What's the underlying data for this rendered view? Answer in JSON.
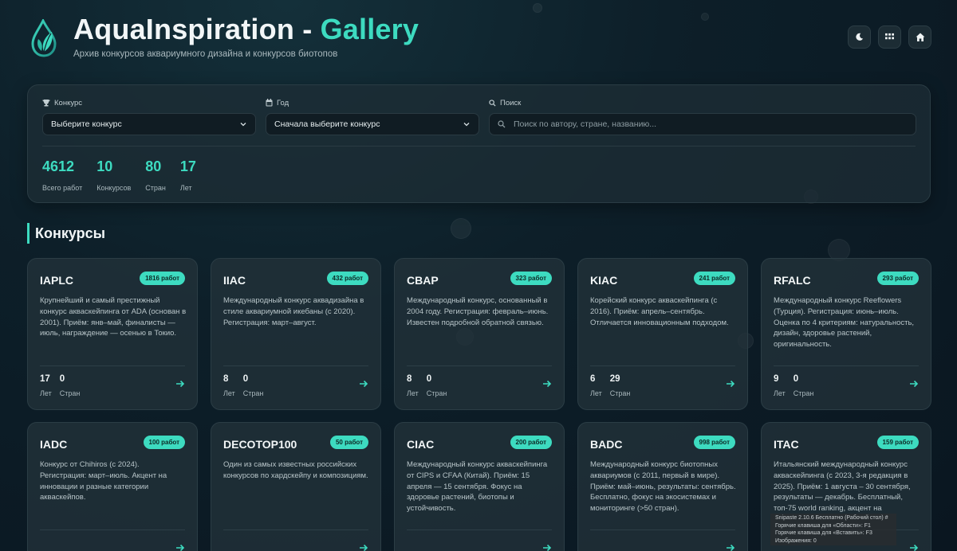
{
  "header": {
    "title_main": "AquaInspiration - ",
    "title_accent": "Gallery",
    "subtitle": "Архив конкурсов аквариумного дизайна и конкурсов биотопов",
    "buttons": [
      {
        "icon": "moon-icon"
      },
      {
        "icon": "grid-icon"
      },
      {
        "icon": "home-icon"
      }
    ]
  },
  "filters": {
    "contest": {
      "label": "Конкурс",
      "icon": "trophy-icon",
      "value": "Выберите конкурс"
    },
    "year": {
      "label": "Год",
      "icon": "calendar-icon",
      "value": "Сначала выберите конкурс"
    },
    "search": {
      "label": "Поиск",
      "icon": "search-icon",
      "placeholder": "Поиск по автору, стране, названию..."
    }
  },
  "stats": [
    {
      "value": "4612",
      "label": "Всего работ"
    },
    {
      "value": "10",
      "label": "Конкурсов"
    },
    {
      "value": "80",
      "label": "Стран"
    },
    {
      "value": "17",
      "label": "Лет"
    }
  ],
  "section": {
    "title": "Конкурсы"
  },
  "card_labels": {
    "years": "Лет",
    "countries": "Стран"
  },
  "cards": [
    {
      "name": "IAPLC",
      "badge": "1816 работ",
      "desc": "Крупнейший и самый престижный конкурс акваскейпинга от ADA (основан в 2001). Приём: янв–май, финалисты — июль, награждение — осенью в Токио.",
      "years": "17",
      "countries": "0"
    },
    {
      "name": "IIAC",
      "badge": "432 работ",
      "desc": "Международный конкурс аквадизайна в стиле аквариумной икебаны (с 2020). Регистрация: март–август.",
      "years": "8",
      "countries": "0"
    },
    {
      "name": "CBAP",
      "badge": "323 работ",
      "desc": "Международный конкурс, основанный в 2004 году. Регистрация: февраль–июнь. Известен подробной обратной связью.",
      "years": "8",
      "countries": "0"
    },
    {
      "name": "KIAC",
      "badge": "241 работ",
      "desc": "Корейский конкурс акваскейпинга (с 2016). Приём: апрель–сентябрь. Отличается инновационным подходом.",
      "years": "6",
      "countries": "29"
    },
    {
      "name": "RFALC",
      "badge": "293 работ",
      "desc": "Международный конкурс Reeflowers (Турция). Регистрация: июнь–июль. Оценка по 4 критериям: натуральность, дизайн, здоровье растений, оригинальность.",
      "years": "9",
      "countries": "0"
    },
    {
      "name": "IADC",
      "badge": "100 работ",
      "desc": "Конкурс от Chihiros (с 2024). Регистрация: март–июль. Акцент на инновации и разные категории аквaскейпов.",
      "years": "",
      "countries": ""
    },
    {
      "name": "DECOTOP100",
      "badge": "50 работ",
      "desc": "Один из самых известных российских конкурсов по хардскейпу и композициям.",
      "years": "",
      "countries": ""
    },
    {
      "name": "CIAC",
      "badge": "200 работ",
      "desc": "Международный конкурс акваскейпинга от CIPS и CFAA (Китай). Приём: 15 апреля — 15 сентября. Фокус на здоровье растений, биотопы и устойчивость.",
      "years": "",
      "countries": ""
    },
    {
      "name": "BADC",
      "badge": "998 работ",
      "desc": "Международный конкурс биотопных аквариумов (с 2011, первый в мире). Приём: май–июнь, результаты: сентябрь. Бесплатно, фокус на экосистемах и мониторинге (>50 стран).",
      "years": "",
      "countries": ""
    },
    {
      "name": "ITAC",
      "badge": "159 работ",
      "desc": "Итальянский международный конкурс акваскейпинга (с 2023, 3-я редакция в 2025). Приём: 1 августа – 30 сентября, результаты — декабрь. Бесплатный, топ-75 world ranking, акцент на",
      "years": "",
      "countries": ""
    }
  ],
  "overlay": {
    "lines": [
      "Snipaste 2.10.6 Бесплатно (Рабочий стол) #",
      "Горячие клавиша для «Области»: F1",
      "Горячие клавиша для «Вставить»: F3",
      "Изображения: 0"
    ]
  },
  "colors": {
    "accent": "#3ddbc0",
    "background": "#0d1f29",
    "card": "#22323a"
  }
}
